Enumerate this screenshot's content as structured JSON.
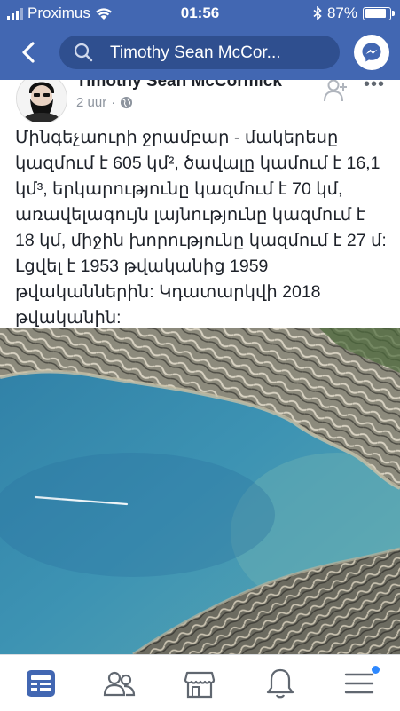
{
  "status": {
    "carrier": "Proximus",
    "time": "01:56",
    "battery": "87%",
    "battery_level": 0.87
  },
  "nav": {
    "search_text": "Timothy Sean McCor..."
  },
  "post": {
    "author": "Timothy Sean McCormick",
    "time": "2 uur",
    "separator": "·",
    "privacy_icon": "globe-icon",
    "text": "Մինգեչաուրի ջրամբար - մակերեսը կազմում է 605 կմ², ծավալը կամում է 16,1 կմ³, երկարությունը կազմում է 70 կմ, առավելագույն լայնությունը կազմում է 18 կմ, միջին խորությունը կազմում է 27 մ: Լցվել է 1953 թվականից 1959 թվականներին: Կդատարկվի 2018 թվականին:"
  },
  "tabs": [
    "news-feed-icon",
    "friends-icon",
    "marketplace-icon",
    "notifications-icon",
    "menu-icon"
  ],
  "colors": {
    "brand": "#4267b2",
    "active_tab": "#4267b2",
    "inactive_tab": "#606770",
    "badge": "#2d88ff"
  }
}
